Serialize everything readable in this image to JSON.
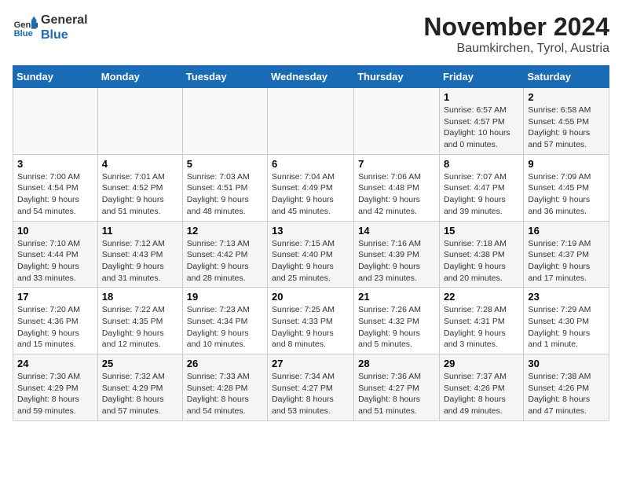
{
  "logo": {
    "line1": "General",
    "line2": "Blue"
  },
  "title": "November 2024",
  "location": "Baumkirchen, Tyrol, Austria",
  "days_of_week": [
    "Sunday",
    "Monday",
    "Tuesday",
    "Wednesday",
    "Thursday",
    "Friday",
    "Saturday"
  ],
  "weeks": [
    [
      {
        "day": "",
        "info": ""
      },
      {
        "day": "",
        "info": ""
      },
      {
        "day": "",
        "info": ""
      },
      {
        "day": "",
        "info": ""
      },
      {
        "day": "",
        "info": ""
      },
      {
        "day": "1",
        "info": "Sunrise: 6:57 AM\nSunset: 4:57 PM\nDaylight: 10 hours\nand 0 minutes."
      },
      {
        "day": "2",
        "info": "Sunrise: 6:58 AM\nSunset: 4:55 PM\nDaylight: 9 hours\nand 57 minutes."
      }
    ],
    [
      {
        "day": "3",
        "info": "Sunrise: 7:00 AM\nSunset: 4:54 PM\nDaylight: 9 hours\nand 54 minutes."
      },
      {
        "day": "4",
        "info": "Sunrise: 7:01 AM\nSunset: 4:52 PM\nDaylight: 9 hours\nand 51 minutes."
      },
      {
        "day": "5",
        "info": "Sunrise: 7:03 AM\nSunset: 4:51 PM\nDaylight: 9 hours\nand 48 minutes."
      },
      {
        "day": "6",
        "info": "Sunrise: 7:04 AM\nSunset: 4:49 PM\nDaylight: 9 hours\nand 45 minutes."
      },
      {
        "day": "7",
        "info": "Sunrise: 7:06 AM\nSunset: 4:48 PM\nDaylight: 9 hours\nand 42 minutes."
      },
      {
        "day": "8",
        "info": "Sunrise: 7:07 AM\nSunset: 4:47 PM\nDaylight: 9 hours\nand 39 minutes."
      },
      {
        "day": "9",
        "info": "Sunrise: 7:09 AM\nSunset: 4:45 PM\nDaylight: 9 hours\nand 36 minutes."
      }
    ],
    [
      {
        "day": "10",
        "info": "Sunrise: 7:10 AM\nSunset: 4:44 PM\nDaylight: 9 hours\nand 33 minutes."
      },
      {
        "day": "11",
        "info": "Sunrise: 7:12 AM\nSunset: 4:43 PM\nDaylight: 9 hours\nand 31 minutes."
      },
      {
        "day": "12",
        "info": "Sunrise: 7:13 AM\nSunset: 4:42 PM\nDaylight: 9 hours\nand 28 minutes."
      },
      {
        "day": "13",
        "info": "Sunrise: 7:15 AM\nSunset: 4:40 PM\nDaylight: 9 hours\nand 25 minutes."
      },
      {
        "day": "14",
        "info": "Sunrise: 7:16 AM\nSunset: 4:39 PM\nDaylight: 9 hours\nand 23 minutes."
      },
      {
        "day": "15",
        "info": "Sunrise: 7:18 AM\nSunset: 4:38 PM\nDaylight: 9 hours\nand 20 minutes."
      },
      {
        "day": "16",
        "info": "Sunrise: 7:19 AM\nSunset: 4:37 PM\nDaylight: 9 hours\nand 17 minutes."
      }
    ],
    [
      {
        "day": "17",
        "info": "Sunrise: 7:20 AM\nSunset: 4:36 PM\nDaylight: 9 hours\nand 15 minutes."
      },
      {
        "day": "18",
        "info": "Sunrise: 7:22 AM\nSunset: 4:35 PM\nDaylight: 9 hours\nand 12 minutes."
      },
      {
        "day": "19",
        "info": "Sunrise: 7:23 AM\nSunset: 4:34 PM\nDaylight: 9 hours\nand 10 minutes."
      },
      {
        "day": "20",
        "info": "Sunrise: 7:25 AM\nSunset: 4:33 PM\nDaylight: 9 hours\nand 8 minutes."
      },
      {
        "day": "21",
        "info": "Sunrise: 7:26 AM\nSunset: 4:32 PM\nDaylight: 9 hours\nand 5 minutes."
      },
      {
        "day": "22",
        "info": "Sunrise: 7:28 AM\nSunset: 4:31 PM\nDaylight: 9 hours\nand 3 minutes."
      },
      {
        "day": "23",
        "info": "Sunrise: 7:29 AM\nSunset: 4:30 PM\nDaylight: 9 hours\nand 1 minute."
      }
    ],
    [
      {
        "day": "24",
        "info": "Sunrise: 7:30 AM\nSunset: 4:29 PM\nDaylight: 8 hours\nand 59 minutes."
      },
      {
        "day": "25",
        "info": "Sunrise: 7:32 AM\nSunset: 4:29 PM\nDaylight: 8 hours\nand 57 minutes."
      },
      {
        "day": "26",
        "info": "Sunrise: 7:33 AM\nSunset: 4:28 PM\nDaylight: 8 hours\nand 54 minutes."
      },
      {
        "day": "27",
        "info": "Sunrise: 7:34 AM\nSunset: 4:27 PM\nDaylight: 8 hours\nand 53 minutes."
      },
      {
        "day": "28",
        "info": "Sunrise: 7:36 AM\nSunset: 4:27 PM\nDaylight: 8 hours\nand 51 minutes."
      },
      {
        "day": "29",
        "info": "Sunrise: 7:37 AM\nSunset: 4:26 PM\nDaylight: 8 hours\nand 49 minutes."
      },
      {
        "day": "30",
        "info": "Sunrise: 7:38 AM\nSunset: 4:26 PM\nDaylight: 8 hours\nand 47 minutes."
      }
    ]
  ]
}
